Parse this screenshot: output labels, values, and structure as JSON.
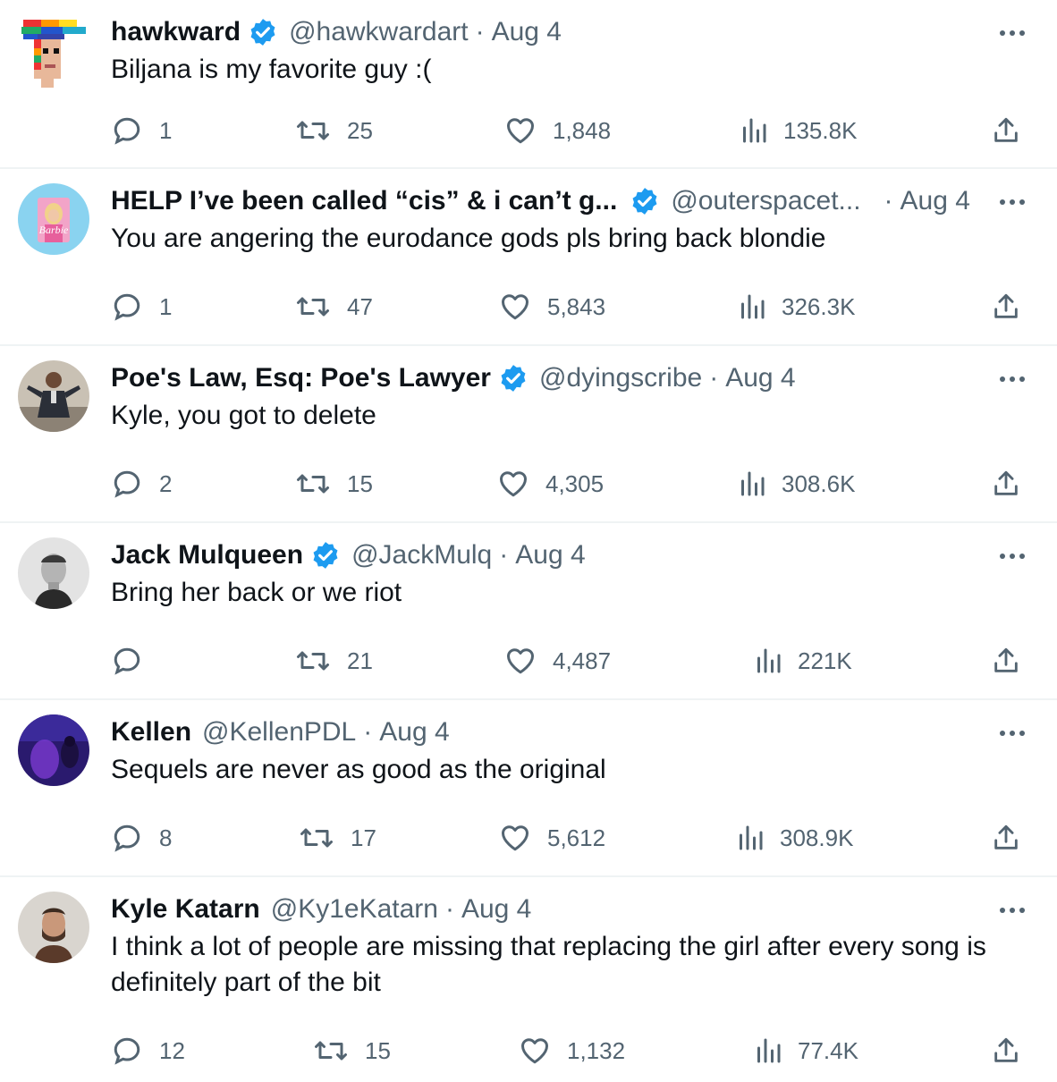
{
  "tweets": [
    {
      "name": "hawkward",
      "verified": true,
      "handle": "@hawkwardart",
      "date": "Aug 4",
      "text": "Biljana is my favorite guy :(",
      "replies": "1",
      "retweets": "25",
      "likes": "1,848",
      "views": "135.8K"
    },
    {
      "name": "HELP I’ve been called “cis” & i can’t g...",
      "verified": true,
      "handle": "@outerspacet...",
      "date": "Aug 4",
      "text": "You are angering the eurodance gods pls bring back blondie",
      "replies": "1",
      "retweets": "47",
      "likes": "5,843",
      "views": "326.3K"
    },
    {
      "name": "Poe's Law, Esq: Poe's Lawyer",
      "verified": true,
      "handle": "@dyingscribe",
      "date": "Aug 4",
      "text": "Kyle, you got to delete",
      "replies": "2",
      "retweets": "15",
      "likes": "4,305",
      "views": "308.6K"
    },
    {
      "name": "Jack Mulqueen",
      "verified": true,
      "handle": "@JackMulq",
      "date": "Aug 4",
      "text": "Bring her back or we riot",
      "replies": "",
      "retweets": "21",
      "likes": "4,487",
      "views": "221K"
    },
    {
      "name": "Kellen",
      "verified": false,
      "handle": "@KellenPDL",
      "date": "Aug 4",
      "text": "Sequels are never as good as the original",
      "replies": "8",
      "retweets": "17",
      "likes": "5,612",
      "views": "308.9K"
    },
    {
      "name": "Kyle Katarn",
      "verified": false,
      "handle": "@Ky1eKatarn",
      "date": "Aug 4",
      "text": "I think a lot of people are missing that replacing the girl after every song is definitely part of the bit",
      "replies": "12",
      "retweets": "15",
      "likes": "1,132",
      "views": "77.4K"
    }
  ],
  "separator": "·",
  "colors": {
    "primary_text": "#0f1419",
    "secondary_text": "#536471",
    "verified_badge": "#1d9bf0",
    "divider": "#eff3f4"
  },
  "icons": {
    "reply": "reply-icon",
    "retweet": "retweet-icon",
    "like": "heart-icon",
    "views": "views-icon",
    "share": "share-icon",
    "more": "more-icon",
    "verified": "verified-badge-icon"
  }
}
